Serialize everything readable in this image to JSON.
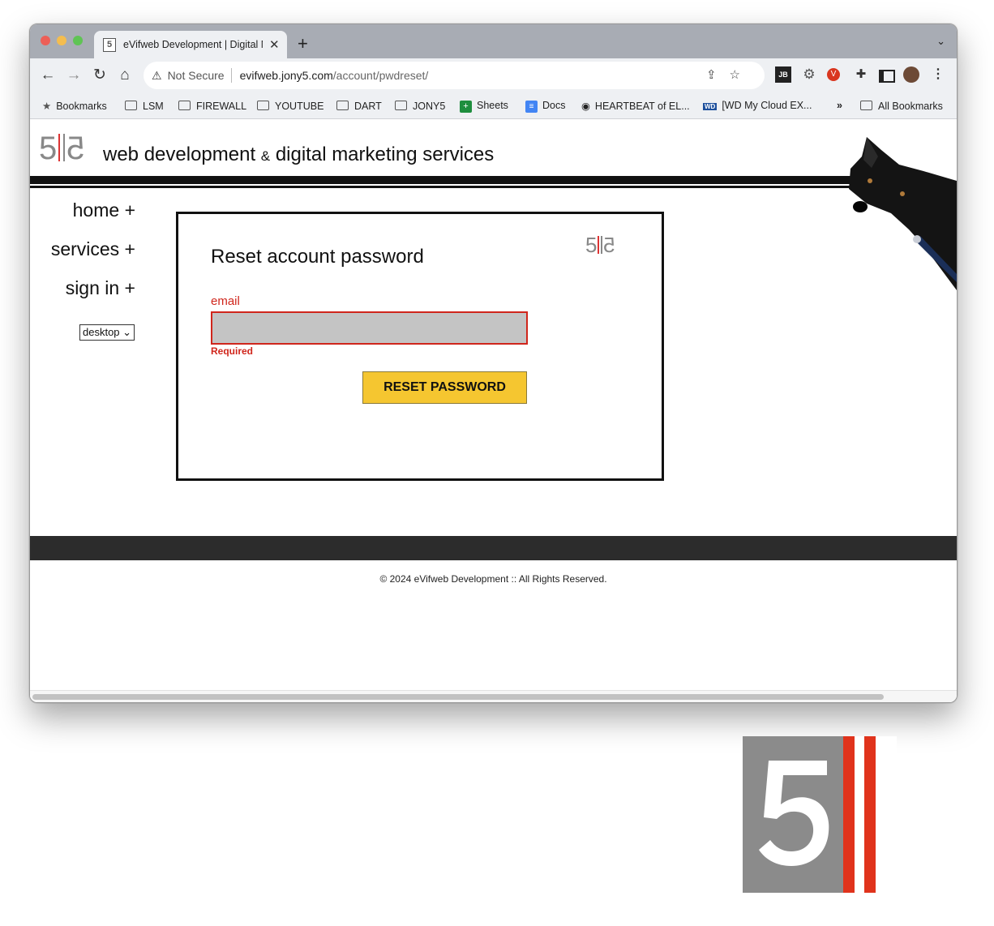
{
  "browser": {
    "tab": {
      "favicon": "5",
      "title": "eVifweb Development | Digital M"
    },
    "new_tab_icon": "plus-icon",
    "address_bar": {
      "security_text": "Not Secure",
      "url_host": "evifweb.jony5.com",
      "url_path": "/account/pwdreset/"
    },
    "bookmarks": [
      {
        "label": "Bookmarks",
        "icon": "star-icon"
      },
      {
        "label": "LSM",
        "icon": "folder-icon"
      },
      {
        "label": "FIREWALL",
        "icon": "folder-icon"
      },
      {
        "label": "YOUTUBE",
        "icon": "folder-icon"
      },
      {
        "label": "DART",
        "icon": "folder-icon"
      },
      {
        "label": "JONY5",
        "icon": "folder-icon"
      },
      {
        "label": "Sheets",
        "icon": "sheets-icon"
      },
      {
        "label": "Docs",
        "icon": "docs-icon"
      },
      {
        "label": "HEARTBEAT of EL...",
        "icon": "globe-icon"
      },
      {
        "label": "[WD My Cloud EX...",
        "icon": "wd-icon"
      }
    ],
    "overflow": "»",
    "all_bookmarks": "All Bookmarks"
  },
  "site": {
    "logo_text": "5",
    "tagline_part1": "web development",
    "tagline_amp": "&",
    "tagline_part2": "digital marketing services",
    "nav": [
      {
        "label": "home +"
      },
      {
        "label": "services +"
      },
      {
        "label": "sign in +"
      }
    ],
    "view_select": "desktop"
  },
  "form": {
    "title": "Reset account password",
    "email_label": "email",
    "email_value": "",
    "validation": "Required",
    "submit_label": "RESET PASSWORD"
  },
  "footer": {
    "copyright": "© 2024 eVifweb Development :: All Rights Reserved."
  },
  "colors": {
    "accent_yellow": "#f5c630",
    "error_red": "#d0261c",
    "footer_band": "#2c2c2c"
  }
}
